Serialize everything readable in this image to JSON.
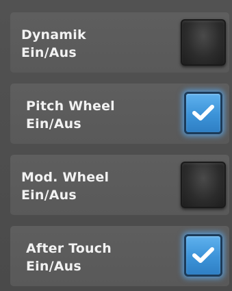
{
  "rows": [
    {
      "line1": "Dynamik",
      "line2": "Ein/Aus",
      "checked": false
    },
    {
      "line1": "Pitch Wheel",
      "line2": "Ein/Aus",
      "checked": true
    },
    {
      "line1": "Mod. Wheel",
      "line2": "Ein/Aus",
      "checked": false
    },
    {
      "line1": "After Touch",
      "line2": "Ein/Aus",
      "checked": true
    }
  ],
  "colors": {
    "accent": "#3c93d8",
    "glow": "#5aaaf0",
    "text": "#f2f2f2",
    "row_bg": "#5b5b5b",
    "page_bg": "#4e4e4e"
  },
  "icons": {
    "checked": "checkmark-icon"
  }
}
